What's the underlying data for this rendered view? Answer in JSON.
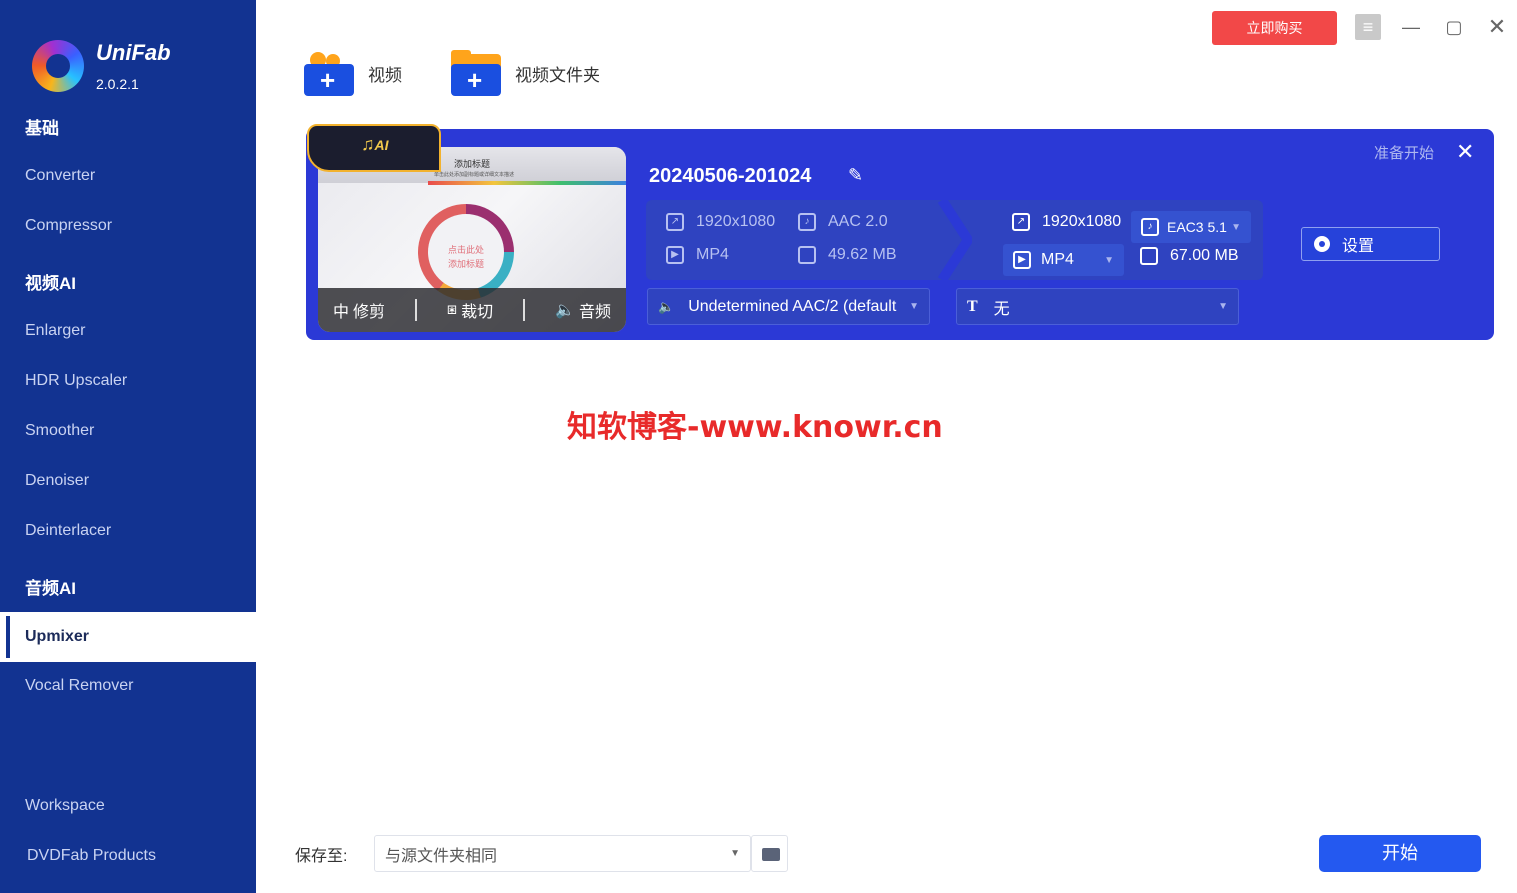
{
  "app": {
    "brand": "UniFab",
    "version": "2.0.2.1"
  },
  "sidebar": {
    "sections": [
      {
        "title": "基础",
        "items": [
          "Converter",
          "Compressor"
        ]
      },
      {
        "title": "视频AI",
        "items": [
          "Enlarger",
          "HDR Upscaler",
          "Smoother",
          "Denoiser",
          "Deinterlacer"
        ]
      },
      {
        "title": "音频AI",
        "items": [
          "Upmixer",
          "Vocal Remover"
        ]
      }
    ],
    "active_item": "Upmixer",
    "footer_items": [
      "Workspace",
      "DVDFab Products"
    ]
  },
  "titlebar": {
    "buy_label": "立即购买"
  },
  "toolbar": {
    "add_video_label": "视频",
    "add_folder_label": "视频文件夹"
  },
  "task": {
    "file_name": "20240506-201024",
    "status": "准备开始",
    "thumbnail": {
      "title": "添加标题",
      "subtitle": "单击此处添加副标题或详细文本描述",
      "center_text_1": "点击此处",
      "center_text_2": "添加标题",
      "badge": "AI"
    },
    "thumb_actions": {
      "trim": "修剪",
      "crop": "裁切",
      "audio": "音频"
    },
    "source": {
      "resolution": "1920x1080",
      "audio": "AAC 2.0",
      "format": "MP4",
      "size": "49.62 MB"
    },
    "output": {
      "resolution": "1920x1080",
      "audio_codec": "EAC3 5.1",
      "format": "MP4",
      "size": "67.00 MB"
    },
    "settings_label": "设置",
    "audio_track": "Undetermined AAC/2 (default",
    "subtitle_track": "无"
  },
  "watermark": "知软博客-www.knowr.cn",
  "bottom": {
    "save_to_label": "保存至:",
    "save_to_value": "与源文件夹相同",
    "start_label": "开始"
  },
  "colors": {
    "sidebar_bg": "#123391",
    "card_bg": "#2b39d6",
    "buy_button": "#f24848",
    "start_button": "#2459f0",
    "accent_orange": "#ffa41b"
  }
}
